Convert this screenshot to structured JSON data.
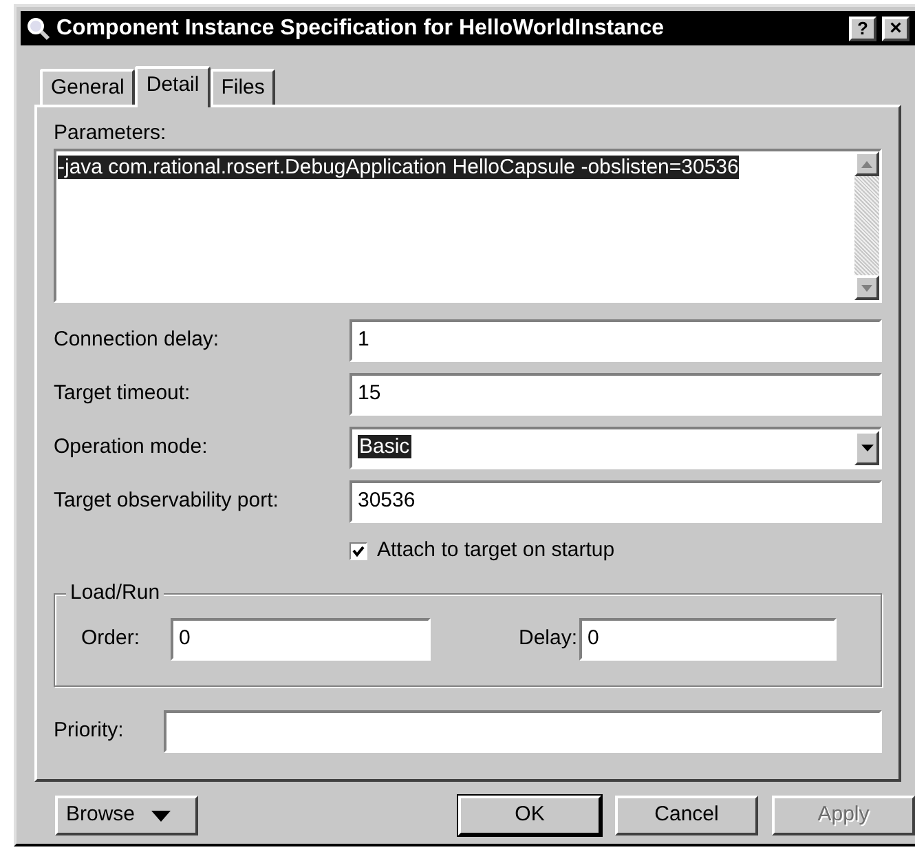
{
  "window": {
    "title": "Component Instance Specification for HelloWorldInstance",
    "help_button": "?",
    "close_button": "×"
  },
  "tabs": [
    {
      "label": "General",
      "selected": false
    },
    {
      "label": "Detail",
      "selected": true
    },
    {
      "label": "Files",
      "selected": false
    }
  ],
  "parameters": {
    "label": "Parameters:",
    "value": "-java com.rational.rosert.DebugApplication HelloCapsule -obslisten=30536",
    "highlighted": true
  },
  "fields": [
    {
      "kind": "text",
      "label": "Connection delay:",
      "value": "1"
    },
    {
      "kind": "text",
      "label": "Target timeout:",
      "value": "15"
    },
    {
      "kind": "select",
      "label": "Operation mode:",
      "value": "Basic"
    },
    {
      "kind": "text",
      "label": "Target observability port:",
      "value": "30536"
    }
  ],
  "attach": {
    "label": "Attach to target on startup",
    "checked": true
  },
  "load_run": {
    "title": "Load/Run",
    "order_label": "Order:",
    "order_value": "0",
    "delay_label": "Delay:",
    "delay_value": "0"
  },
  "priority": {
    "label": "Priority:"
  },
  "buttons": [
    {
      "kind": "menu",
      "label": "Browse",
      "disabled": false
    },
    {
      "kind": "push",
      "label": "OK",
      "disabled": false,
      "default": true
    },
    {
      "kind": "push",
      "label": "Cancel",
      "disabled": false,
      "default": false
    },
    {
      "kind": "push",
      "label": "Apply",
      "disabled": true,
      "default": false
    }
  ]
}
